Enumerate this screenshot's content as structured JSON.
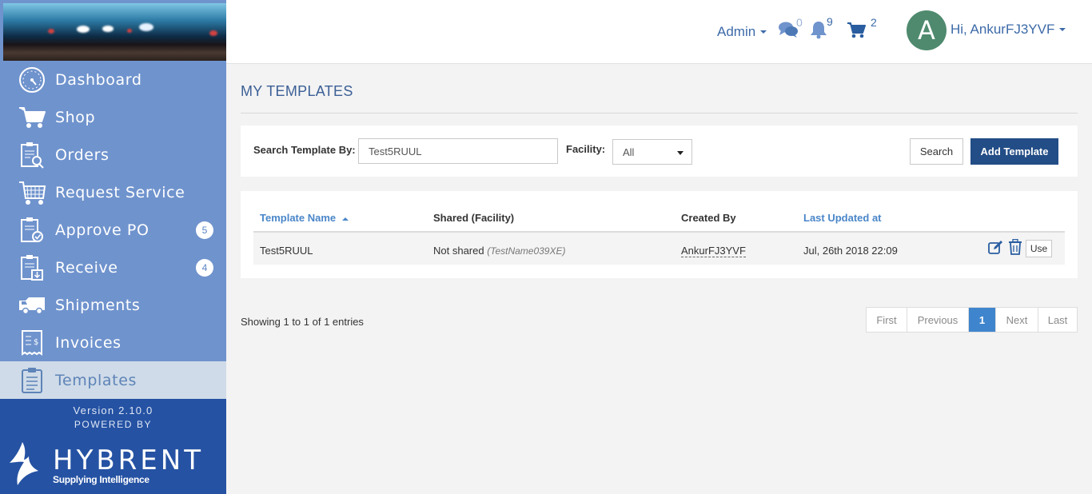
{
  "sidebar": {
    "items": [
      {
        "label": "Dashboard",
        "icon": "dashboard-icon"
      },
      {
        "label": "Shop",
        "icon": "cart-icon"
      },
      {
        "label": "Orders",
        "icon": "orders-icon"
      },
      {
        "label": "Request Service",
        "icon": "request-service-icon"
      },
      {
        "label": "Approve PO",
        "icon": "approve-po-icon",
        "badge": "5"
      },
      {
        "label": "Receive",
        "icon": "receive-icon",
        "badge": "4"
      },
      {
        "label": "Shipments",
        "icon": "truck-icon"
      },
      {
        "label": "Invoices",
        "icon": "invoice-icon"
      },
      {
        "label": "Templates",
        "icon": "templates-icon",
        "active": true
      }
    ],
    "footer": {
      "version": "Version 2.10.0",
      "powered_by": "POWERED BY",
      "brand": "HYBRENT",
      "tagline": "Supplying Intelligence"
    }
  },
  "topbar": {
    "admin_label": "Admin",
    "messages_count": "0",
    "notifications_count": "9",
    "cart_count": "2",
    "avatar_letter": "A",
    "greeting": "Hi, AnkurFJ3YVF"
  },
  "page": {
    "title": "MY TEMPLATES"
  },
  "search": {
    "label": "Search Template By:",
    "value": "Test5RUUL",
    "facility_label": "Facility:",
    "facility_value": "All",
    "search_button": "Search",
    "add_button": "Add Template"
  },
  "table": {
    "headers": {
      "name": "Template Name",
      "shared": "Shared (Facility)",
      "created_by": "Created By",
      "updated": "Last Updated at"
    },
    "rows": [
      {
        "name": "Test5RUUL",
        "shared": "Not shared",
        "shared_facility": "(TestName039XE)",
        "created_by": "AnkurFJ3YVF",
        "updated": "Jul, 26th 2018 22:09",
        "use_label": "Use"
      }
    ]
  },
  "pagination": {
    "info": "Showing 1 to 1 of 1 entries",
    "first": "First",
    "previous": "Previous",
    "current": "1",
    "next": "Next",
    "last": "Last"
  },
  "colors": {
    "sidebar": "#6f93cd",
    "sidebar_footer": "#2552a3",
    "primary": "#234d86",
    "link": "#4a86c8"
  }
}
